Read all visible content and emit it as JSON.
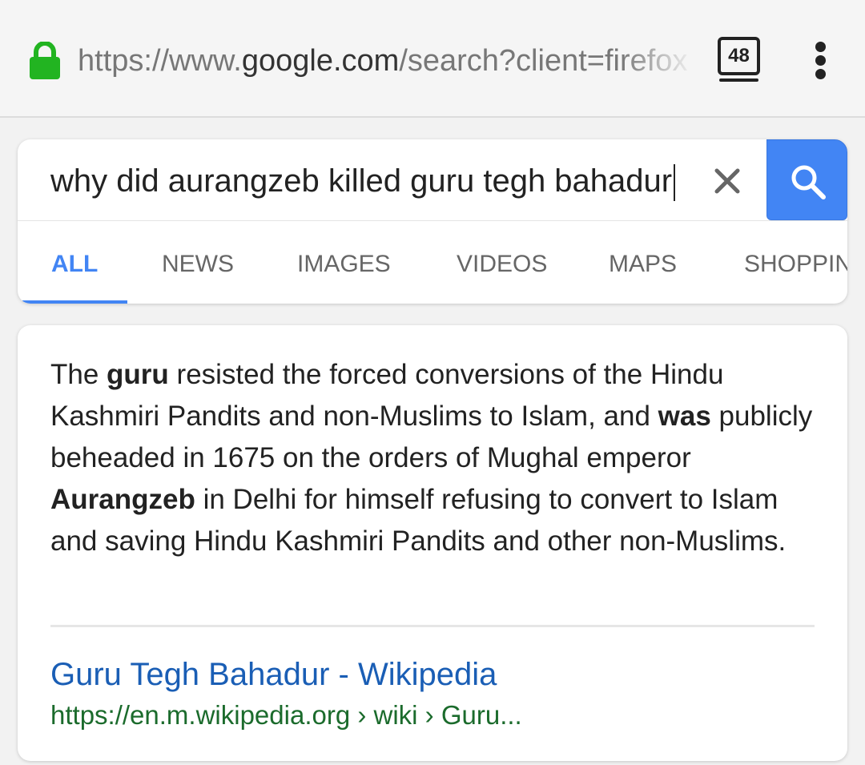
{
  "browser": {
    "url_scheme": "https://www.",
    "url_host": "google.com",
    "url_path": "/search?client=firefox",
    "tab_count": "48",
    "lock_color": "#22b421"
  },
  "search": {
    "query": "why did aurangzeb killed guru tegh bahadur",
    "accent_color": "#4285f4"
  },
  "tabs": [
    {
      "label": "ALL",
      "active": true
    },
    {
      "label": "NEWS"
    },
    {
      "label": "IMAGES"
    },
    {
      "label": "VIDEOS"
    },
    {
      "label": "MAPS"
    },
    {
      "label": "SHOPPIN"
    }
  ],
  "result": {
    "snippet_parts": [
      "The ",
      "guru",
      " resisted the forced conversions of the Hindu Kashmiri Pandits and non-Muslims to Islam, and ",
      "was",
      " publicly beheaded in 1675 on the orders of Mughal emperor ",
      "Aurangzeb",
      " in Delhi for himself refusing to convert to Islam and saving Hindu Kashmiri Pandits and other non-Muslims."
    ],
    "title": "Guru Tegh Bahadur - Wikipedia",
    "url": "https://en.m.wikipedia.org › wiki › Guru..."
  }
}
